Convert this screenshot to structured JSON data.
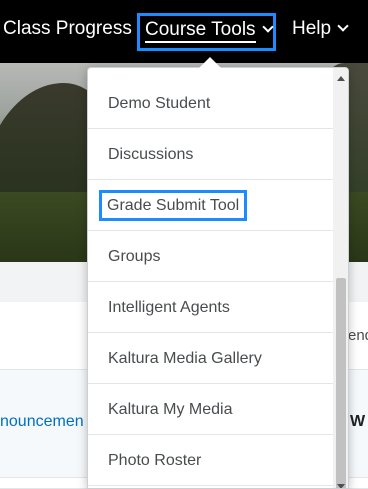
{
  "nav": {
    "class_progress": "Class Progress",
    "course_tools": "Course Tools",
    "help": "Help"
  },
  "dropdown": {
    "items": [
      {
        "label": "Demo Student"
      },
      {
        "label": "Discussions"
      },
      {
        "label": "Grade Submit Tool"
      },
      {
        "label": "Groups"
      },
      {
        "label": "Intelligent Agents"
      },
      {
        "label": "Kaltura Media Gallery"
      },
      {
        "label": "Kaltura My Media"
      },
      {
        "label": "Photo Roster"
      }
    ]
  },
  "page": {
    "announcements_link": "nouncemen",
    "end_text": "end",
    "w_text": "W"
  },
  "colors": {
    "nav_bg": "#000000",
    "focus_outline": "#1a8cff",
    "link": "#006fbf",
    "menu_text": "#494c4e"
  }
}
